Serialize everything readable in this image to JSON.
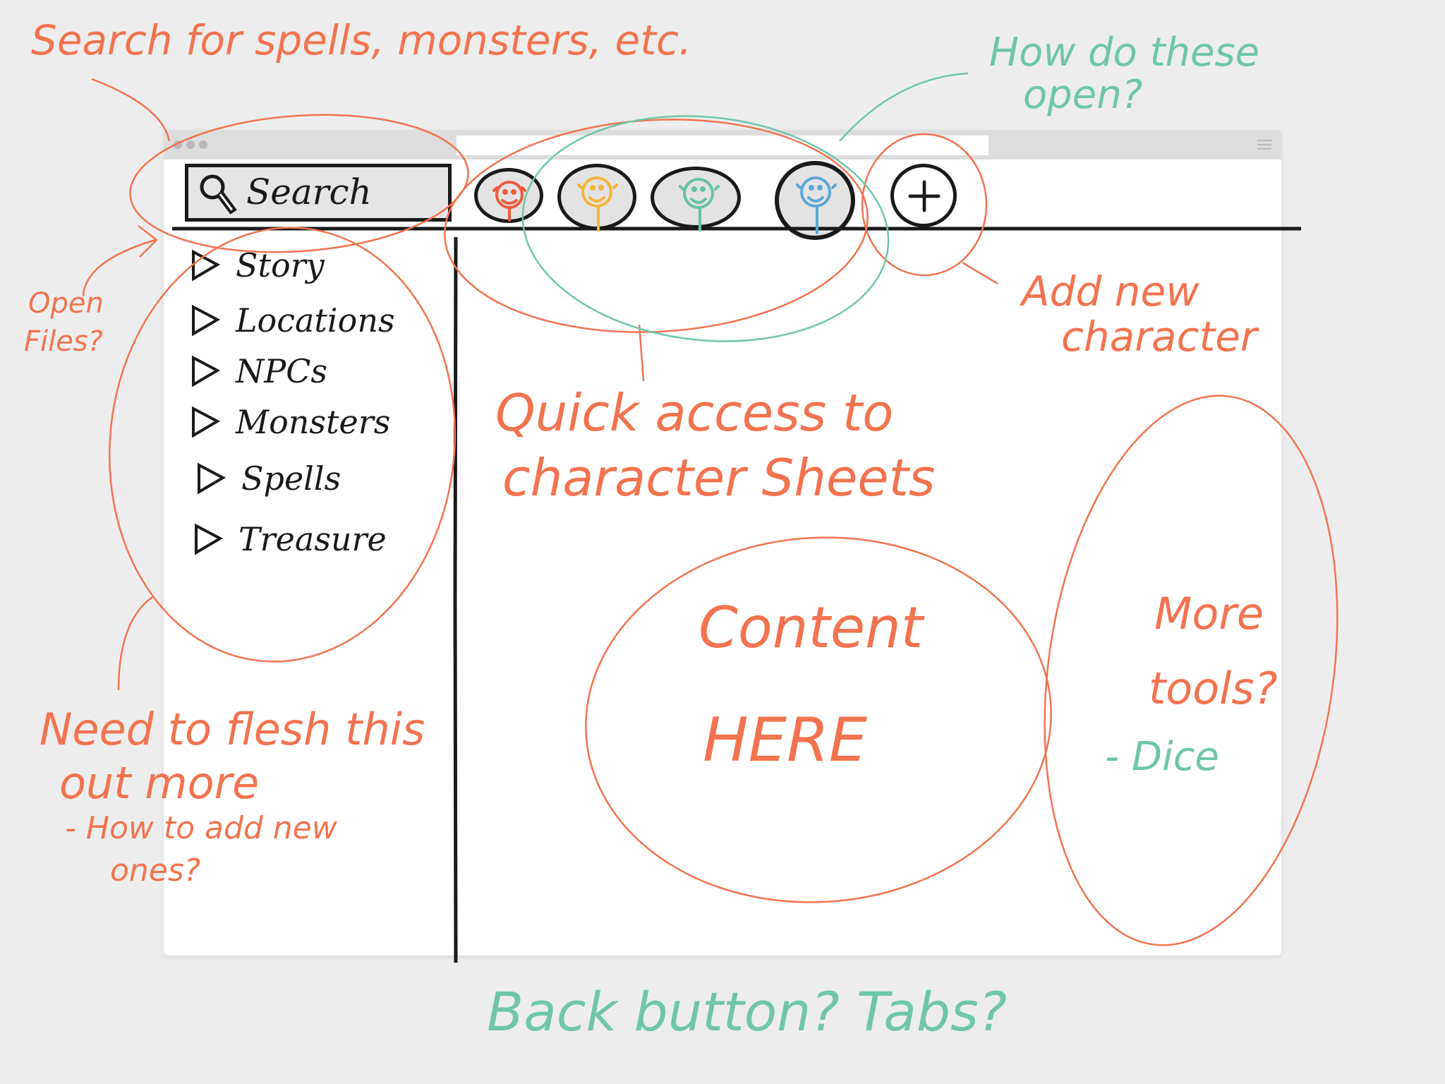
{
  "colors": {
    "annotation_orange": "#f2734f",
    "annotation_teal": "#6fc6a8",
    "ink": "#1a1a1a",
    "avatar_colors": [
      "#ef5a3c",
      "#f5b53a",
      "#66c2a5",
      "#5aa7d6"
    ]
  },
  "toolbar": {
    "search_label": "Search",
    "search_icon": "magnifier-icon",
    "characters": [
      {
        "icon": "character-face-icon",
        "color": "#ef5a3c"
      },
      {
        "icon": "character-face-icon",
        "color": "#f5b53a"
      },
      {
        "icon": "character-face-icon",
        "color": "#66c2a5"
      },
      {
        "icon": "character-face-icon",
        "color": "#5aa7d6"
      }
    ],
    "add_icon": "plus-icon"
  },
  "sidebar": {
    "items": [
      {
        "label": "Story",
        "icon": "triangle-expand-icon"
      },
      {
        "label": "Locations",
        "icon": "triangle-expand-icon"
      },
      {
        "label": "NPCs",
        "icon": "triangle-expand-icon"
      },
      {
        "label": "Monsters",
        "icon": "triangle-expand-icon"
      },
      {
        "label": "Spells",
        "icon": "triangle-expand-icon"
      },
      {
        "label": "Treasure",
        "icon": "triangle-expand-icon"
      }
    ]
  },
  "annotations": {
    "search_note": "Search for spells, monsters, etc.",
    "open_question_line1": "How do these",
    "open_question_line2": "open?",
    "open_files_line1": "Open",
    "open_files_line2": "Files?",
    "add_character_line1": "Add new",
    "add_character_line2": "character",
    "quick_access_line1": "Quick access to",
    "quick_access_line2": "character Sheets",
    "content_line1": "Content",
    "content_line2": "HERE",
    "more_tools_line1": "More",
    "more_tools_line2": "tools?",
    "dice_note": "- Dice",
    "flesh_out_line1": "Need to flesh this",
    "flesh_out_line2": "out more",
    "add_new_line1": "- How to add new",
    "add_new_line2": "ones?",
    "bottom_note": "Back button? Tabs?"
  }
}
